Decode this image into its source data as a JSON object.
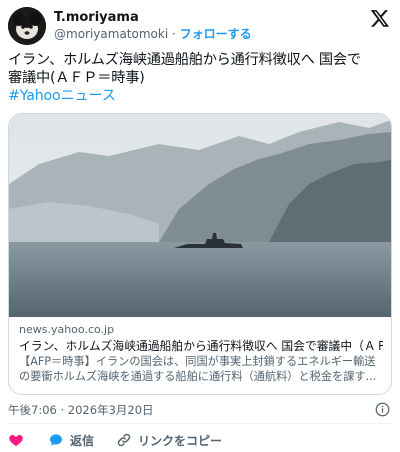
{
  "author": {
    "display_name": "T.moriyama",
    "handle": "@moriyamatomoki",
    "separator": "·",
    "follow_label": "フォローする"
  },
  "tweet": {
    "line1": "イラン、ホルムズ海峡通過船舶から通行料徴収へ 国会で",
    "line2": "審議中(ＡＦＰ＝時事)",
    "hashtag": "#Yahooニュース"
  },
  "card": {
    "domain": "news.yahoo.co.jp",
    "title": "イラン、ホルムズ海峡通過船舶から通行料徴収へ 国会で審議中（ＡＦ...",
    "desc_line1": "【AFP＝時事】イランの国会は、同国が事実上封鎖するエネルギー輸送",
    "desc_line2": "の要衝ホルムズ海峡を通過する船舶に通行料（通航料）と税金を課す..."
  },
  "meta": {
    "time": "午後7:06",
    "separator": "·",
    "date": "2026年3月20日"
  },
  "actions": {
    "reply_label": "返信",
    "copy_label": "リンクをコピー"
  },
  "colors": {
    "accent": "#1d9bf0",
    "like": "#f91880",
    "muted": "#536471",
    "border": "#cfd9de"
  },
  "icons": [
    "avatar-dog",
    "x-logo-icon",
    "info-icon",
    "heart-icon",
    "reply-icon",
    "link-icon"
  ]
}
